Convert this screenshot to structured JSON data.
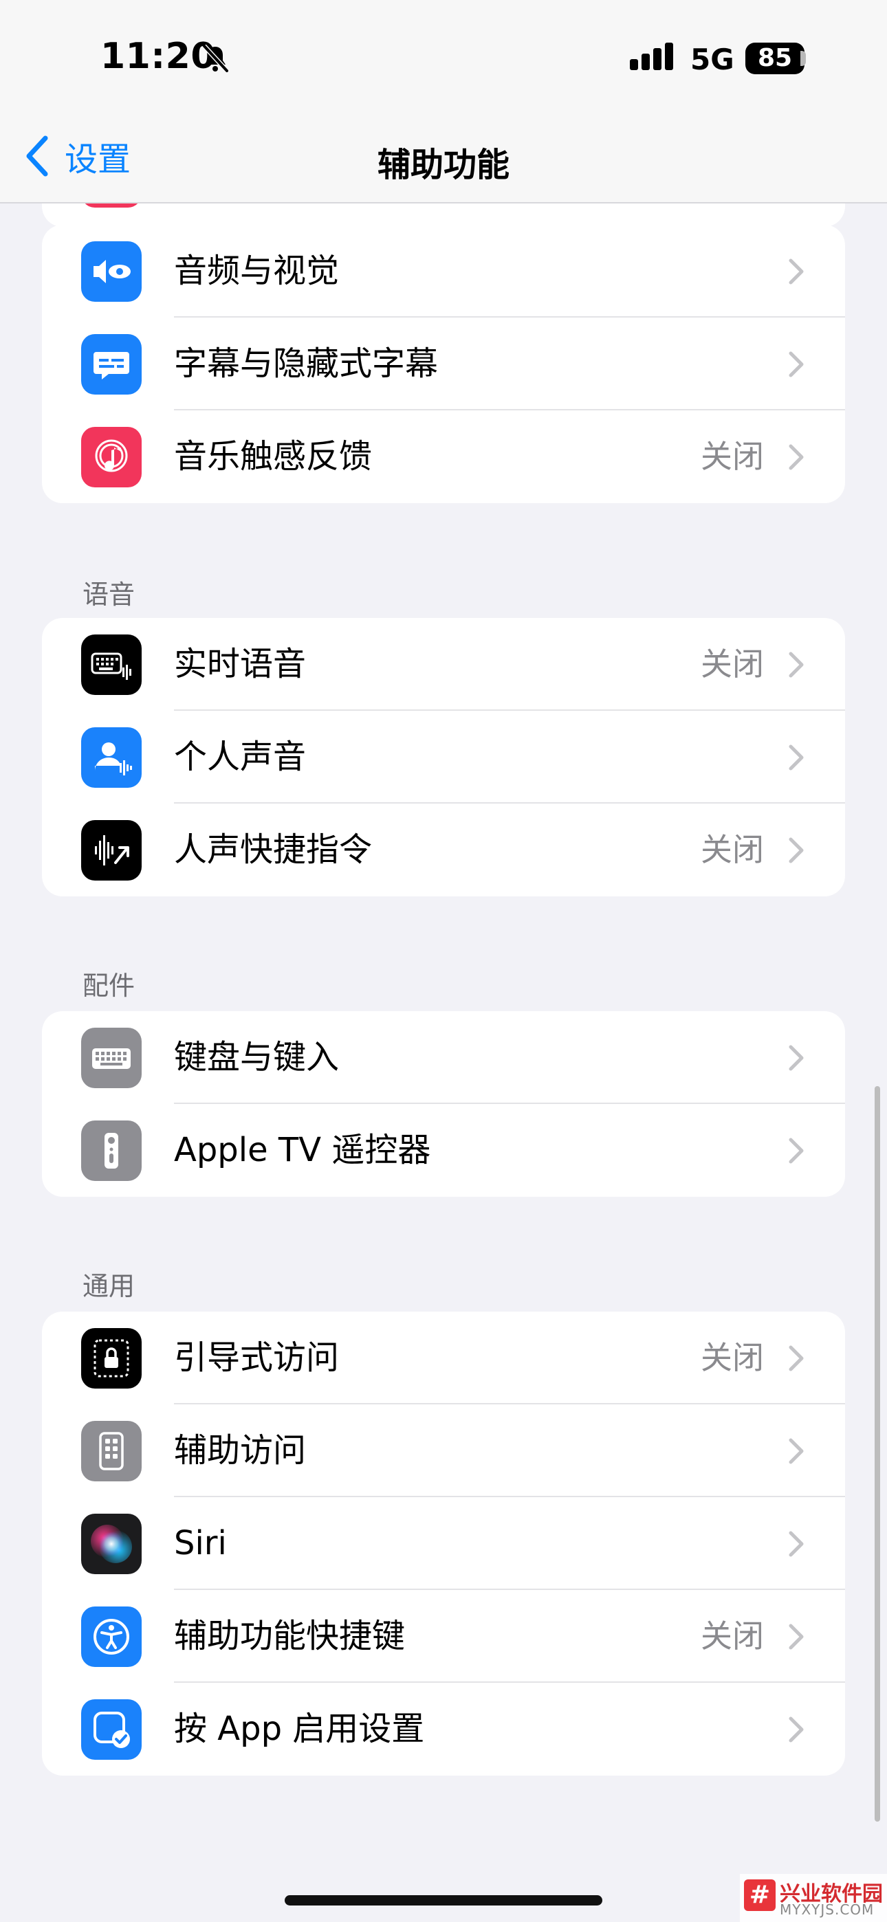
{
  "status_bar": {
    "time": "11:20",
    "network": "5G",
    "battery": "85"
  },
  "nav": {
    "back_label": "设置",
    "title": "辅助功能"
  },
  "colors": {
    "accent": "#0a84ff",
    "background": "#f2f2f7"
  },
  "groups": [
    {
      "header": "",
      "rows": [
        {
          "icon": "audio-visual-icon",
          "color": "#1a82fb",
          "label": "音频与视觉",
          "value": ""
        },
        {
          "icon": "subtitles-icon",
          "color": "#1a82fb",
          "label": "字幕与隐藏式字幕",
          "value": ""
        },
        {
          "icon": "music-haptics-icon",
          "color": "#f2355b",
          "label": "音乐触感反馈",
          "value": "关闭"
        }
      ]
    },
    {
      "header": "语音",
      "rows": [
        {
          "icon": "live-speech-icon",
          "color": "#000000",
          "label": "实时语音",
          "value": "关闭"
        },
        {
          "icon": "personal-voice-icon",
          "color": "#1a82fb",
          "label": "个人声音",
          "value": ""
        },
        {
          "icon": "vocal-shortcuts-icon",
          "color": "#000000",
          "label": "人声快捷指令",
          "value": "关闭"
        }
      ]
    },
    {
      "header": "配件",
      "rows": [
        {
          "icon": "keyboard-icon",
          "color": "#8e8e93",
          "label": "键盘与键入",
          "value": ""
        },
        {
          "icon": "apple-tv-remote-icon",
          "color": "#8e8e93",
          "label": "Apple TV 遥控器",
          "value": ""
        }
      ]
    },
    {
      "header": "通用",
      "rows": [
        {
          "icon": "guided-access-icon",
          "color": "#000000",
          "label": "引导式访问",
          "value": "关闭"
        },
        {
          "icon": "assistive-access-icon",
          "color": "#8e8e93",
          "label": "辅助访问",
          "value": ""
        },
        {
          "icon": "siri-icon",
          "color": "#1c1c1e",
          "label": "Siri",
          "value": ""
        },
        {
          "icon": "accessibility-shortcut-icon",
          "color": "#1a82fb",
          "label": "辅助功能快捷键",
          "value": "关闭"
        },
        {
          "icon": "per-app-settings-icon",
          "color": "#1a82fb",
          "label": "按 App 启用设置",
          "value": ""
        }
      ]
    }
  ],
  "watermark": {
    "title": "兴业软件园",
    "url": "MYXYJS.COM",
    "logo": "#"
  }
}
